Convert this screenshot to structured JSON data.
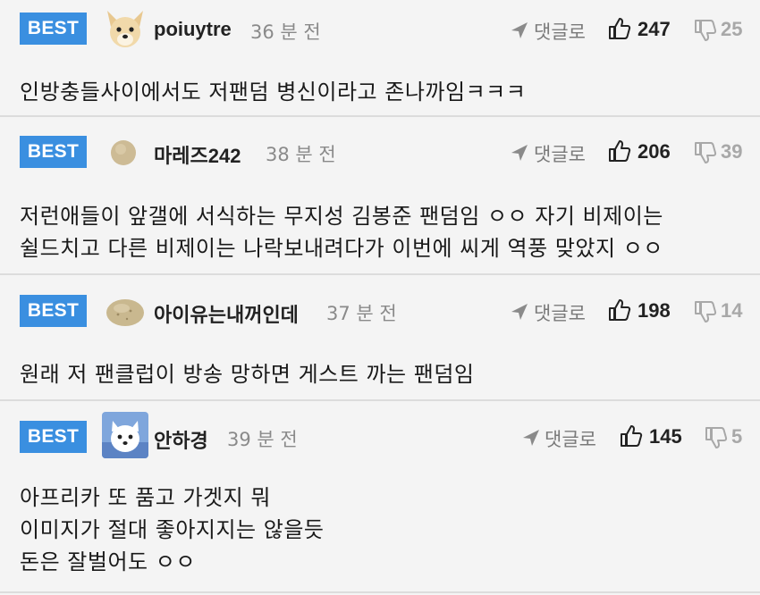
{
  "colors": {
    "best_badge": "#3a8fe0",
    "background": "#f4f4f4",
    "divider": "#dcdcdc",
    "muted_text": "#8a8a8a"
  },
  "comments": [
    {
      "badge": "BEST",
      "avatar_icon": "dog-avatar-icon",
      "username": "poiuytre",
      "time": "36 분 전",
      "reply_label": "댓글로",
      "reply_icon": "send-arrow-icon",
      "like_icon": "thumbs-up-icon",
      "likes": "247",
      "dislike_icon": "thumbs-down-icon",
      "dislikes": "25",
      "lines": [
        "인방충들사이에서도 저팬덤 병신이라고 존나까임ㅋㅋㅋ"
      ]
    },
    {
      "badge": "BEST",
      "avatar_icon": "circle-avatar-icon",
      "username": "마레즈242",
      "time": "38 분 전",
      "reply_label": "댓글로",
      "reply_icon": "send-arrow-icon",
      "like_icon": "thumbs-up-icon",
      "likes": "206",
      "dislike_icon": "thumbs-down-icon",
      "dislikes": "39",
      "lines": [
        "저런애들이 앞갤에 서식하는 무지성 김봉준 팬덤임 ㅇㅇ 자기 비제이는",
        "쉴드치고 다른 비제이는 나락보내려다가 이번에 씨게 역풍 맞았지 ㅇㅇ"
      ]
    },
    {
      "badge": "BEST",
      "avatar_icon": "potato-avatar-icon",
      "username": "아이유는내꺼인데",
      "time": "37 분 전",
      "reply_label": "댓글로",
      "reply_icon": "send-arrow-icon",
      "like_icon": "thumbs-up-icon",
      "likes": "198",
      "dislike_icon": "thumbs-down-icon",
      "dislikes": "14",
      "lines": [
        "원래 저 팬클럽이 방송 망하면 게스트 까는 팬덤임"
      ]
    },
    {
      "badge": "BEST",
      "avatar_icon": "white-dog-avatar-icon",
      "username": "안하경",
      "time": "39 분 전",
      "reply_label": "댓글로",
      "reply_icon": "send-arrow-icon",
      "like_icon": "thumbs-up-icon",
      "likes": "145",
      "dislike_icon": "thumbs-down-icon",
      "dislikes": "5",
      "lines": [
        "아프리카 또 품고 가겟지 뭐",
        "이미지가 절대 좋아지지는 않을듯",
        "돈은 잘벌어도 ㅇㅇ"
      ]
    }
  ]
}
